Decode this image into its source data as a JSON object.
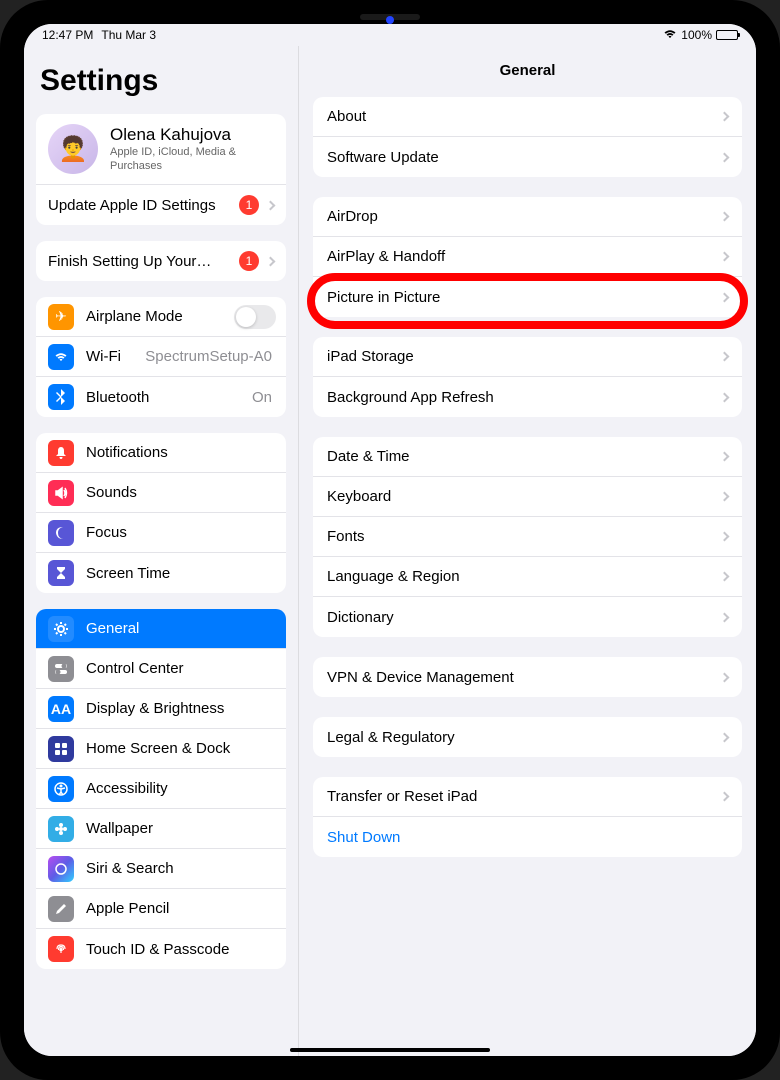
{
  "status": {
    "time": "12:47 PM",
    "date": "Thu Mar 3",
    "battery": "100%"
  },
  "sidebar": {
    "title": "Settings",
    "profile": {
      "name": "Olena Kahujova",
      "subtitle": "Apple ID, iCloud, Media & Purchases"
    },
    "update_apple_id_label": "Update Apple ID Settings",
    "update_apple_id_badge": "1",
    "finish_setup_label": "Finish Setting Up Your…",
    "finish_setup_badge": "1",
    "airplane_mode": "Airplane Mode",
    "wifi_label": "Wi-Fi",
    "wifi_value": "SpectrumSetup-A0",
    "bluetooth_label": "Bluetooth",
    "bluetooth_value": "On",
    "notifications": "Notifications",
    "sounds": "Sounds",
    "focus": "Focus",
    "screen_time": "Screen Time",
    "general": "General",
    "control_center": "Control Center",
    "display_brightness": "Display & Brightness",
    "home_screen_dock": "Home Screen & Dock",
    "accessibility": "Accessibility",
    "wallpaper": "Wallpaper",
    "siri_search": "Siri & Search",
    "apple_pencil": "Apple Pencil",
    "touch_id_passcode": "Touch ID & Passcode"
  },
  "detail": {
    "title": "General",
    "about": "About",
    "software_update": "Software Update",
    "airdrop": "AirDrop",
    "airplay_handoff": "AirPlay & Handoff",
    "picture_in_picture": "Picture in Picture",
    "ipad_storage": "iPad Storage",
    "background_app_refresh": "Background App Refresh",
    "date_time": "Date & Time",
    "keyboard": "Keyboard",
    "fonts": "Fonts",
    "language_region": "Language & Region",
    "dictionary": "Dictionary",
    "vpn_device_management": "VPN & Device Management",
    "legal_regulatory": "Legal & Regulatory",
    "transfer_reset": "Transfer or Reset iPad",
    "shut_down": "Shut Down"
  }
}
